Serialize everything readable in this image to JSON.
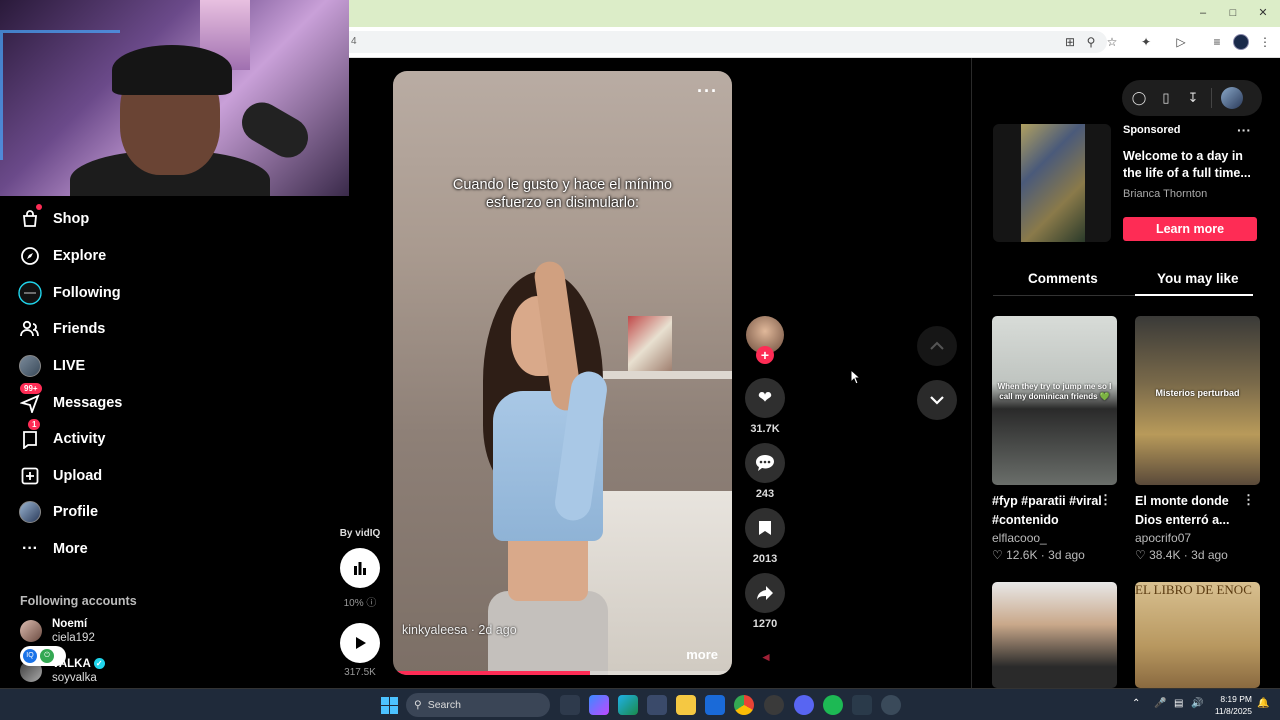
{
  "browser": {
    "address_fragment": "4",
    "window_controls": [
      "minimize-icon",
      "maximize-icon",
      "close-icon"
    ],
    "toolbar_icons": [
      "install-icon",
      "zoom-icon",
      "bookmark-star-icon",
      "extensions-icon",
      "media-icon",
      "tab-search-icon",
      "profile-avatar",
      "kebab-menu-icon"
    ]
  },
  "sidebar": {
    "items": [
      {
        "label": "Shop",
        "icon": "shop-bag-icon"
      },
      {
        "label": "Explore",
        "icon": "compass-icon"
      },
      {
        "label": "Following",
        "icon": "following-ring-icon"
      },
      {
        "label": "Friends",
        "icon": "friends-icon"
      },
      {
        "label": "LIVE",
        "icon": "live-avatar"
      },
      {
        "label": "Messages",
        "icon": "messages-icon",
        "badge": "99+"
      },
      {
        "label": "Activity",
        "icon": "activity-icon",
        "badge": "1"
      },
      {
        "label": "Upload",
        "icon": "upload-icon"
      },
      {
        "label": "Profile",
        "icon": "profile-avatar"
      },
      {
        "label": "More",
        "icon": "more-dots-icon"
      }
    ],
    "following_title": "Following accounts",
    "accounts": [
      {
        "name": "Noemí",
        "handle": "ciela192"
      },
      {
        "name": "VALKA",
        "handle": "soyvalka",
        "verified": true
      }
    ]
  },
  "vidiq": {
    "by": "By vidIQ",
    "percent": "10%",
    "views": "317.5K"
  },
  "video": {
    "caption_line1": "Cuando le gusto y hace el mínimo",
    "caption_line2": "esfuerzo en disimularlo:",
    "author": "kinkyaleesa · 2d ago",
    "more": "more",
    "progress": 0.58
  },
  "actions": {
    "likes": "31.7K",
    "comments": "243",
    "saves": "2013",
    "shares": "1270"
  },
  "right_panel": {
    "ad": {
      "sponsored": "Sponsored",
      "title": "Welcome to a day in the life of a full time...",
      "author": "Brianca Thornton",
      "cta": "Learn more"
    },
    "tabs": [
      "Comments",
      "You may like"
    ],
    "active_tab": "You may like",
    "cards": [
      {
        "thumb_text": "When they try to jump me so I call my dominican friends 💚",
        "title": "#fyp #paratii #viral #contenido",
        "author": "elflacooo_",
        "likes": "12.6K",
        "age": "3d ago"
      },
      {
        "thumb_text": "Misterios perturbad",
        "title": "El monte donde Dios enterró a...",
        "author": "apocrifo07",
        "likes": "38.4K",
        "age": "3d ago"
      },
      {
        "thumb_text": "",
        "title": "",
        "author": "",
        "likes": "",
        "age": ""
      },
      {
        "thumb_text": "EL LIBRO DE ENOC",
        "title": "",
        "author": "",
        "likes": "",
        "age": ""
      }
    ]
  },
  "taskbar": {
    "search": "Search",
    "time": "8:19 PM",
    "date": "11/8/2025"
  },
  "colors": {
    "accent": "#fe2c55",
    "titlebar": "#dcedc8",
    "verified": "#20d5ec"
  }
}
